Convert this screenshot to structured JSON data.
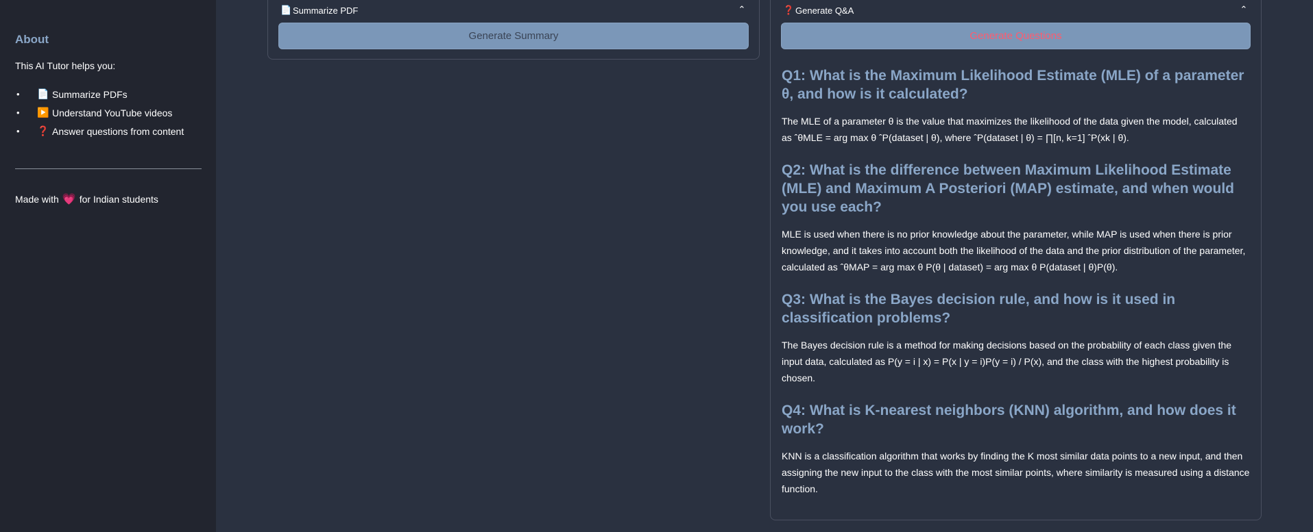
{
  "sidebar": {
    "about_title": "About",
    "helps": "This AI Tutor helps you:",
    "features": [
      {
        "bullet": "•",
        "icon": "📄",
        "icon_name": "pdf-icon",
        "label": "Summarize PDFs"
      },
      {
        "bullet": "•",
        "icon": "▶️",
        "icon_name": "play-icon",
        "label": "Understand YouTube videos"
      },
      {
        "bullet": "•",
        "icon": "❓",
        "icon_name": "question-icon",
        "label": "Answer questions from content"
      }
    ],
    "made_prefix": "Made with",
    "heart": "💗",
    "made_suffix": "for Indian students"
  },
  "summarize": {
    "icon": "📄",
    "title": "Summarize PDF",
    "chevron": "⌃",
    "button": "Generate Summary"
  },
  "qa": {
    "icon": "❓",
    "title": "Generate Q&A",
    "chevron": "⌃",
    "button": "Generate Questions",
    "items": [
      {
        "q": "Q1: What is the Maximum Likelihood Estimate (MLE) of a parameter θ, and how is it calculated?",
        "a": "The MLE of a parameter θ is the value that maximizes the likelihood of the data given the model, calculated as ˆθMLE = arg max θ ˆP(dataset | θ), where ˆP(dataset | θ) = ∏[n, k=1] ˆP(xk | θ)."
      },
      {
        "q": "Q2: What is the difference between Maximum Likelihood Estimate (MLE) and Maximum A Posteriori (MAP) estimate, and when would you use each?",
        "a": "MLE is used when there is no prior knowledge about the parameter, while MAP is used when there is prior knowledge, and it takes into account both the likelihood of the data and the prior distribution of the parameter, calculated as ˆθMAP = arg max θ P(θ | dataset) = arg max θ P(dataset | θ)P(θ)."
      },
      {
        "q": "Q3: What is the Bayes decision rule, and how is it used in classification problems?",
        "a": "The Bayes decision rule is a method for making decisions based on the probability of each class given the input data, calculated as P(y = i | x) = P(x | y = i)P(y = i) / P(x), and the class with the highest probability is chosen."
      },
      {
        "q": "Q4: What is K-nearest neighbors (KNN) algorithm, and how does it work?",
        "a": "KNN is a classification algorithm that works by finding the K most similar data points to a new input, and then assigning the new input to the class with the most similar points, where similarity is measured using a distance function."
      }
    ]
  }
}
